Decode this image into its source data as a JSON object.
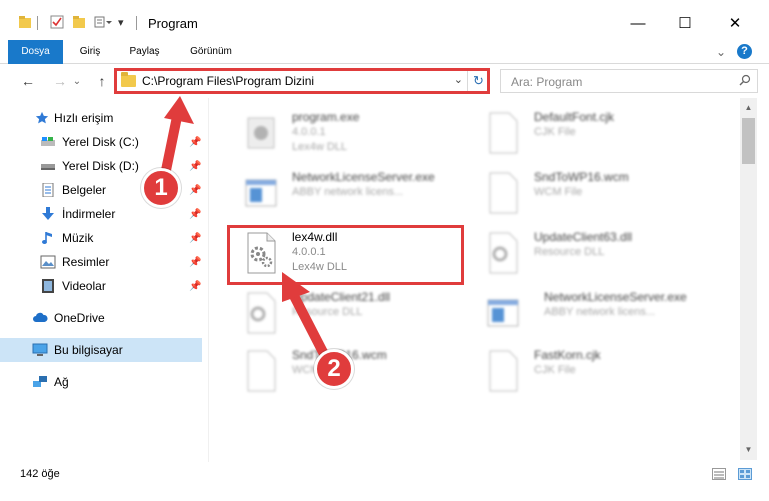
{
  "window": {
    "title": "Program",
    "minimize": "—",
    "maximize": "☐",
    "close": "✕"
  },
  "ribbon": {
    "tabs": [
      {
        "label": "Dosya"
      },
      {
        "label": "Giriş"
      },
      {
        "label": "Paylaş"
      },
      {
        "label": "Görünüm"
      }
    ],
    "expand": "⌄",
    "help": "?"
  },
  "nav": {
    "back": "←",
    "forward": "→",
    "recent": "⌄",
    "up": "↑",
    "address": "C:\\Program Files\\Program Dizini",
    "refresh": "↻",
    "search_placeholder": "Ara: Program"
  },
  "sidebar": {
    "quick_access": "Hızlı erişim",
    "items": [
      {
        "label": "Yerel Disk (C:)",
        "pin": "📌"
      },
      {
        "label": "Yerel Disk (D:)",
        "pin": "📌"
      },
      {
        "label": "Belgeler",
        "pin": "📌"
      },
      {
        "label": "İndirmeler",
        "pin": "📌"
      },
      {
        "label": "Müzik",
        "pin": "📌"
      },
      {
        "label": "Resimler",
        "pin": "📌"
      },
      {
        "label": "Videolar",
        "pin": "📌"
      }
    ],
    "onedrive": "OneDrive",
    "this_pc": "Bu bilgisayar",
    "network": "Ağ"
  },
  "files": {
    "left": [
      {
        "name": "program.exe",
        "line1": "4.0.0.1",
        "line2": "Lex4w DLL"
      },
      {
        "name": "NetworkLicenseServer.exe",
        "line1": "ABBY network licens..."
      },
      {
        "name": "lex4w.dll",
        "line1": "4.0.0.1",
        "line2": "Lex4w DLL"
      },
      {
        "name": "UpdateClient21.dll",
        "line1": "Resource DLL"
      },
      {
        "name": "SndToWP16.wcm",
        "line1": "WCM File"
      }
    ],
    "right": [
      {
        "name": "DefaultFont.cjk",
        "line1": "CJK File"
      },
      {
        "name": "SndToWP16.wcm",
        "line1": "WCM File"
      },
      {
        "name": "UpdateClient63.dll",
        "line1": "Resource DLL"
      },
      {
        "name": "NetworkLicenseServer.exe",
        "line1": "ABBY network licens..."
      },
      {
        "name": "FastKorn.cjk",
        "line1": "CJK File"
      }
    ]
  },
  "status": {
    "count": "142 öğe"
  },
  "annotations": {
    "step1": "1",
    "step2": "2"
  },
  "colors": {
    "highlight": "#e03c3c",
    "accent": "#1979ca",
    "selected": "#cce4f7"
  }
}
